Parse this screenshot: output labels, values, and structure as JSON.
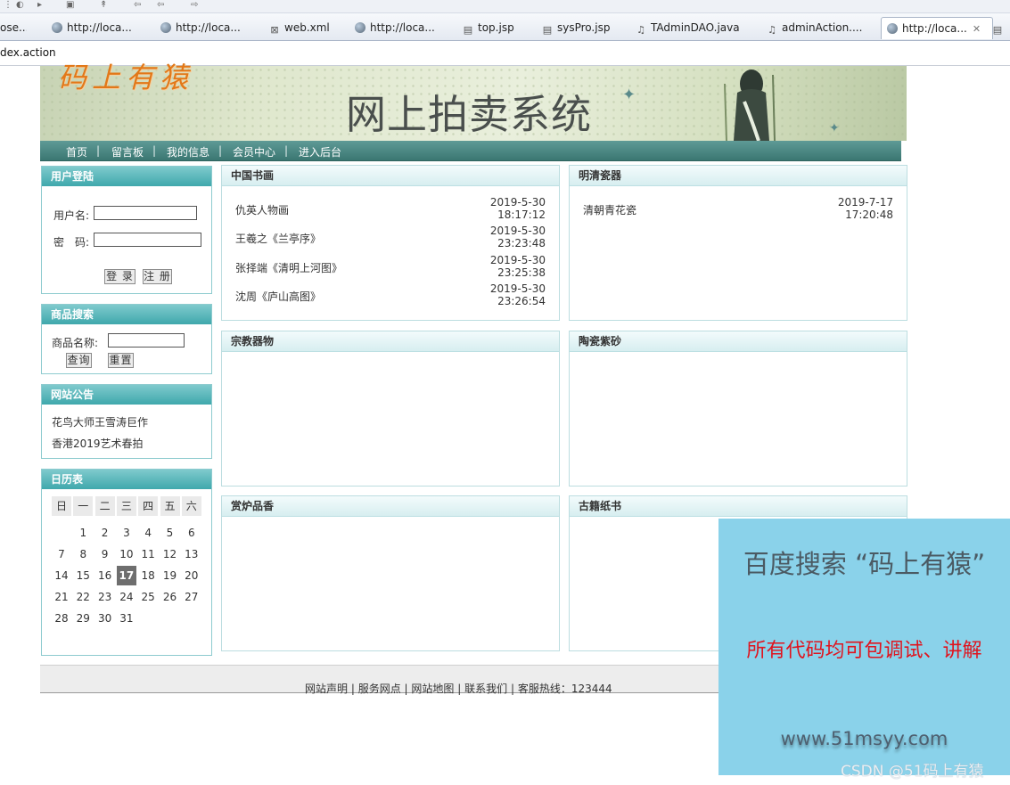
{
  "ide": {
    "tabs": [
      {
        "label": "ose...",
        "icon": "file-icon"
      },
      {
        "label": "http://loca...",
        "icon": "globe-icon"
      },
      {
        "label": "http://loca...",
        "icon": "globe-icon"
      },
      {
        "label": "web.xml",
        "icon": "xml-file-icon"
      },
      {
        "label": "http://loca...",
        "icon": "globe-icon"
      },
      {
        "label": "top.jsp",
        "icon": "file-icon"
      },
      {
        "label": "sysPro.jsp",
        "icon": "file-icon"
      },
      {
        "label": "TAdminDAO.java",
        "icon": "java-file-icon"
      },
      {
        "label": "adminAction....",
        "icon": "java-file-icon"
      },
      {
        "label": "http://loca...",
        "icon": "globe-icon",
        "active": true
      }
    ],
    "url": "dex.action"
  },
  "header": {
    "brand_logo": "码上有猿",
    "site_title": "网上拍卖系统",
    "colors": {
      "brand": "#e27819",
      "nav": "#3b7772",
      "panel_head": "#3fa8ac"
    }
  },
  "nav": {
    "items": [
      "首页",
      "留言板",
      "我的信息",
      "会员中心",
      "进入后台"
    ],
    "separator": "|"
  },
  "login": {
    "title": "用户登陆",
    "username_label": "用户名:",
    "password_label": "密　码:",
    "username_value": "",
    "password_value": "",
    "login_button": "登 录",
    "register_button": "注 册"
  },
  "search": {
    "title": "商品搜索",
    "name_label": "商品名称:",
    "name_value": "",
    "query_button": "查询",
    "reset_button": "重置"
  },
  "notices": {
    "title": "网站公告",
    "items": [
      "花鸟大师王雪涛巨作",
      "香港2019艺术春拍"
    ]
  },
  "calendar": {
    "title": "日历表",
    "weekdays": [
      "日",
      "一",
      "二",
      "三",
      "四",
      "五",
      "六"
    ],
    "weeks": [
      [
        "",
        "1",
        "2",
        "3",
        "4",
        "5",
        "6"
      ],
      [
        "7",
        "8",
        "9",
        "10",
        "11",
        "12",
        "13"
      ],
      [
        "14",
        "15",
        "16",
        "17",
        "18",
        "19",
        "20"
      ],
      [
        "21",
        "22",
        "23",
        "24",
        "25",
        "26",
        "27"
      ],
      [
        "28",
        "29",
        "30",
        "31",
        "",
        "",
        ""
      ]
    ],
    "today": "17"
  },
  "categories": [
    {
      "title": "中国书画",
      "items": [
        {
          "name": "仇英人物画",
          "date": "2019-5-30",
          "time": "18:17:12"
        },
        {
          "name": "王羲之《兰亭序》",
          "date": "2019-5-30",
          "time": "23:23:48"
        },
        {
          "name": "张择端《清明上河图》",
          "date": "2019-5-30",
          "time": "23:25:38"
        },
        {
          "name": "沈周《庐山高图》",
          "date": "2019-5-30",
          "time": "23:26:54"
        }
      ]
    },
    {
      "title": "明清瓷器",
      "items": [
        {
          "name": "清朝青花瓷",
          "date": "2019-7-17",
          "time": "17:20:48"
        }
      ]
    },
    {
      "title": "宗教器物",
      "items": []
    },
    {
      "title": "陶瓷紫砂",
      "items": []
    },
    {
      "title": "赏炉品香",
      "items": []
    },
    {
      "title": "古籍纸书",
      "items": []
    }
  ],
  "footer": {
    "links": [
      "网站声明",
      "服务网点",
      "网站地图",
      "联系我们"
    ],
    "hotline": "客服热线：123444"
  },
  "ad": {
    "title": "百度搜索 “码上有猿”",
    "subtitle": "所有代码均可包调试、讲解",
    "url": "www.51msyy.com"
  },
  "watermark": "CSDN @51码上有猿"
}
